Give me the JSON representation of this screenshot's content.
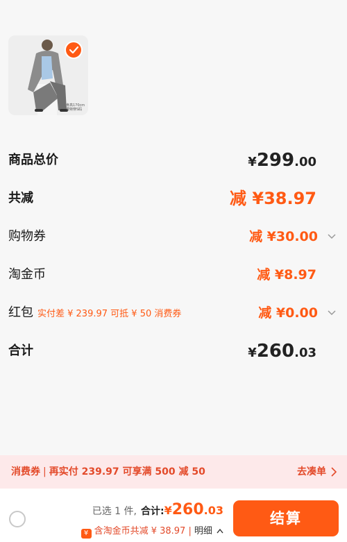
{
  "item": {
    "image_alt": "商品图片",
    "tag_line1": "身高170cm",
    "tag_line2": "模特穿S码"
  },
  "summary": {
    "total_label": "商品总价",
    "total_yen": "¥",
    "total_int": "299",
    "total_dec": ".00",
    "discount_label": "共减",
    "discount_value": "减 ¥38.97",
    "coupon_label": "购物券",
    "coupon_value": "减 ¥30.00",
    "coins_label": "淘金币",
    "coins_value": "减 ¥8.97",
    "redpacket_label": "红包",
    "redpacket_hint": "实付差 ¥ 239.97 可抵 ¥ 50 消费券",
    "redpacket_value": "减 ¥0.00",
    "grand_label": "合计",
    "grand_yen": "¥",
    "grand_int": "260",
    "grand_dec": ".03"
  },
  "promo": {
    "tag": "消费券",
    "separator": "|",
    "text": "再实付 239.97 可享满 500 减 50",
    "action": "去凑单"
  },
  "bottom": {
    "selected_text": "已选 1 件,",
    "total_label": "合计:",
    "yen": "¥",
    "amount_int": "260",
    "amount_dec": ".03",
    "coin_icon": "¥",
    "coin_text": "含淘金币共减 ¥ 38.97 |",
    "detail_label": "明细",
    "checkout_label": "结算"
  },
  "colors": {
    "accent": "#ff5a14",
    "promo_bg": "#fde9ea"
  }
}
